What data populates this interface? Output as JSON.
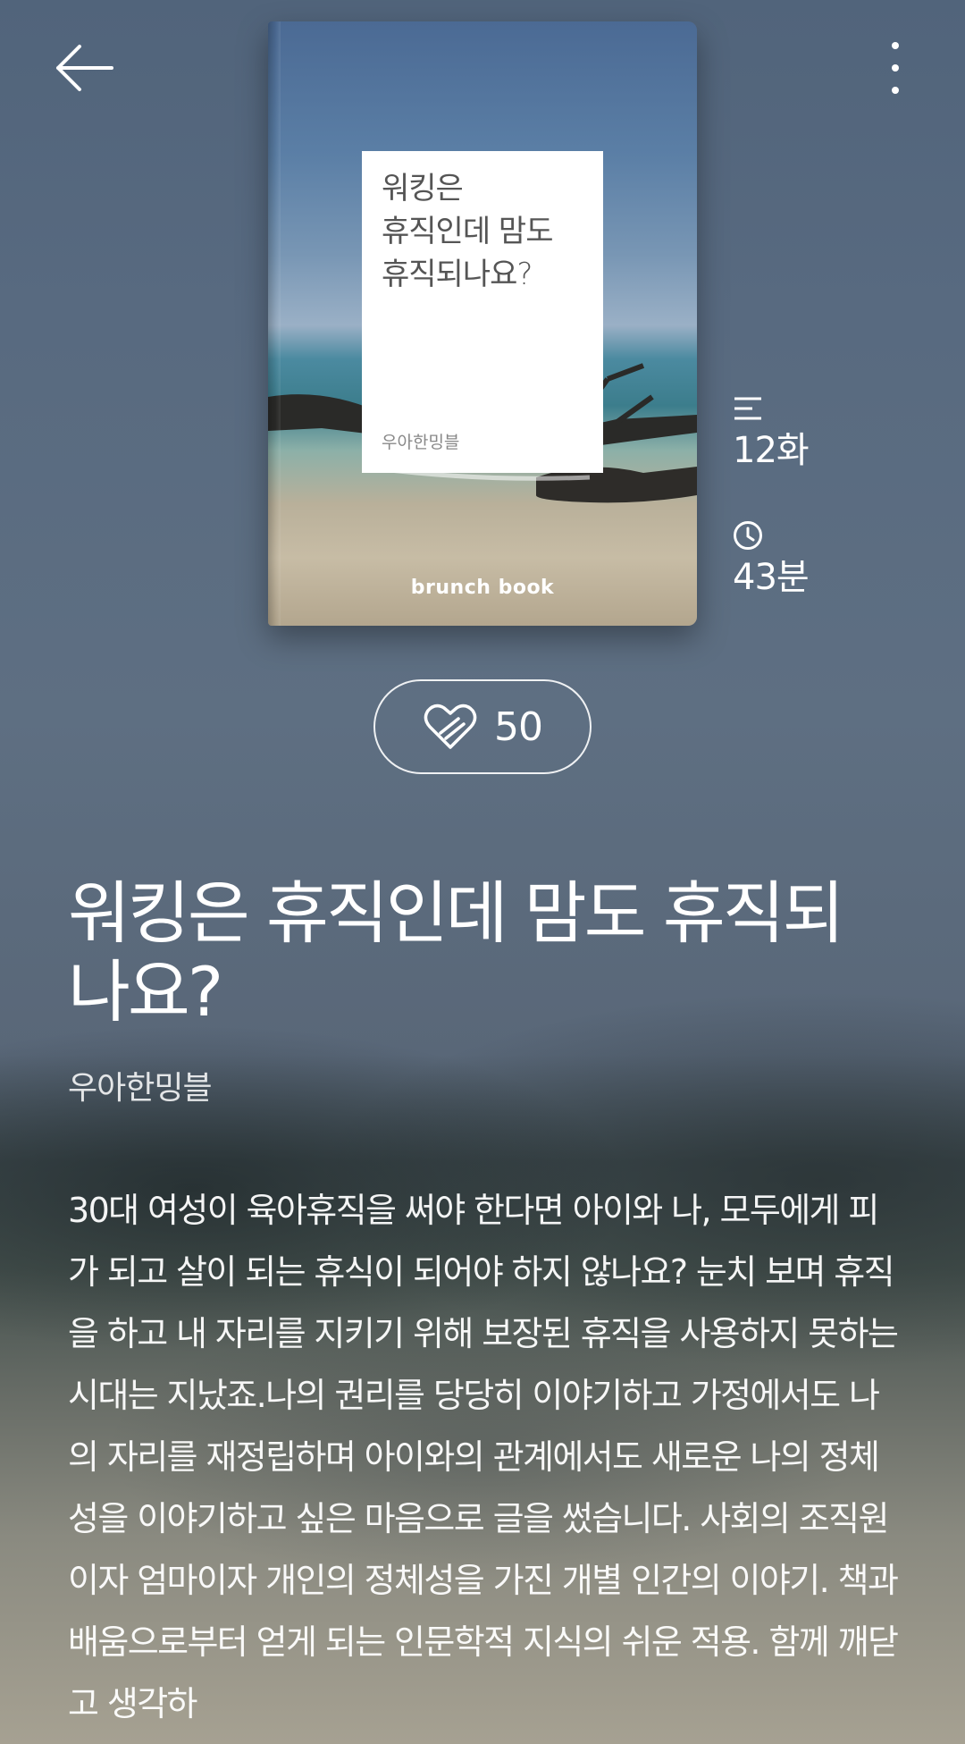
{
  "header": {
    "back_icon": "arrow-left-icon",
    "more_icon": "more-vertical-icon"
  },
  "cover": {
    "title": "워킹은\n휴직인데 맘도\n휴직되나요?",
    "author": "우아한밍블",
    "brand": "brunch book"
  },
  "stats": {
    "episodes_icon": "list-icon",
    "episodes": "12화",
    "time_icon": "clock-icon",
    "reading_time": "43분"
  },
  "like": {
    "icon": "heart-icon",
    "count": "50"
  },
  "book": {
    "title": "워킹은 휴직인데 맘도 휴직되나요?",
    "author": "우아한밍블",
    "description": "30대 여성이 육아휴직을 써야 한다면 아이와 나, 모두에게 피가 되고 살이 되는 휴식이 되어야 하지 않나요?  눈치 보며 휴직을 하고 내 자리를 지키기 위해 보장된 휴직을 사용하지 못하는 시대는 지났죠.나의 권리를 당당히 이야기하고 가정에서도 나의 자리를 재정립하며 아이와의 관계에서도 새로운 나의 정체성을 이야기하고 싶은 마음으로 글을 썼습니다. 사회의 조직원이자 엄마이자 개인의 정체성을 가진 개별 인간의 이야기. 책과 배움으로부터 얻게 되는 인문학적 지식의 쉬운 적용. 함께 깨닫고 생각하"
  }
}
